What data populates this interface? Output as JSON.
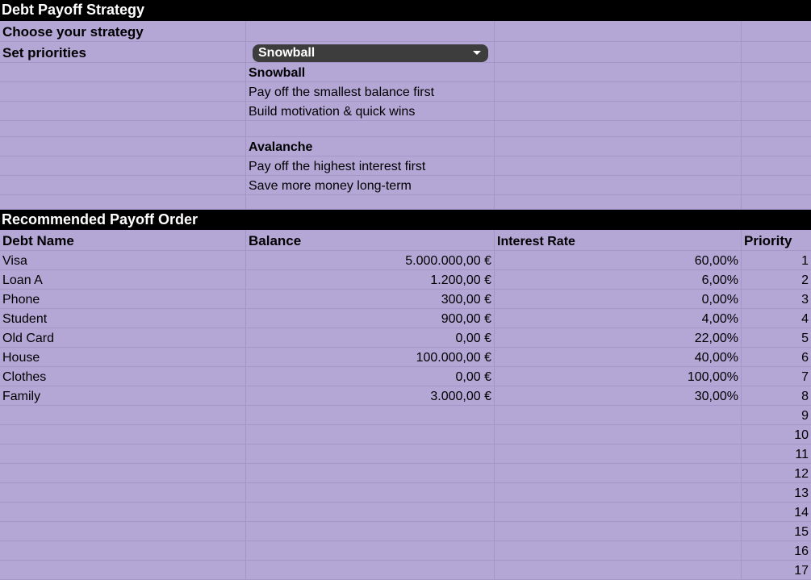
{
  "title": "Debt Payoff Strategy",
  "choose_label": "Choose your strategy",
  "set_label": "Set priorities",
  "strategy_select": {
    "value": "Snowball",
    "icon": "chevron-down-icon"
  },
  "strategies": [
    {
      "name": "Snowball",
      "desc1": "Pay off the smallest balance first",
      "desc2": "Build motivation & quick wins"
    },
    {
      "name": "Avalanche",
      "desc1": "Pay off the highest interest first",
      "desc2": "Save more money long-term"
    }
  ],
  "section_title": "Recommended Payoff Order",
  "columns": {
    "name": "Debt Name",
    "balance": "Balance",
    "rate": "Interest Rate",
    "priority": "Priority"
  },
  "debts": [
    {
      "name": "Visa",
      "balance": "5.000.000,00 €",
      "rate": "60,00%",
      "priority": "1"
    },
    {
      "name": "Loan A",
      "balance": "1.200,00 €",
      "rate": "6,00%",
      "priority": "2"
    },
    {
      "name": "Phone",
      "balance": "300,00 €",
      "rate": "0,00%",
      "priority": "3"
    },
    {
      "name": "Student",
      "balance": "900,00 €",
      "rate": "4,00%",
      "priority": "4"
    },
    {
      "name": "Old Card",
      "balance": "0,00 €",
      "rate": "22,00%",
      "priority": "5"
    },
    {
      "name": "House",
      "balance": "100.000,00 €",
      "rate": "40,00%",
      "priority": "6"
    },
    {
      "name": "Clothes",
      "balance": "0,00 €",
      "rate": "100,00%",
      "priority": "7"
    },
    {
      "name": "Family",
      "balance": "3.000,00 €",
      "rate": "30,00%",
      "priority": "8"
    },
    {
      "name": "",
      "balance": "",
      "rate": "",
      "priority": "9"
    },
    {
      "name": "",
      "balance": "",
      "rate": "",
      "priority": "10"
    },
    {
      "name": "",
      "balance": "",
      "rate": "",
      "priority": "11"
    },
    {
      "name": "",
      "balance": "",
      "rate": "",
      "priority": "12"
    },
    {
      "name": "",
      "balance": "",
      "rate": "",
      "priority": "13"
    },
    {
      "name": "",
      "balance": "",
      "rate": "",
      "priority": "14"
    },
    {
      "name": "",
      "balance": "",
      "rate": "",
      "priority": "15"
    },
    {
      "name": "",
      "balance": "",
      "rate": "",
      "priority": "16"
    },
    {
      "name": "",
      "balance": "",
      "rate": "",
      "priority": "17"
    }
  ],
  "colors": {
    "background": "#b4a7d6",
    "band": "#000000",
    "dropdown": "#3d3d3d"
  }
}
